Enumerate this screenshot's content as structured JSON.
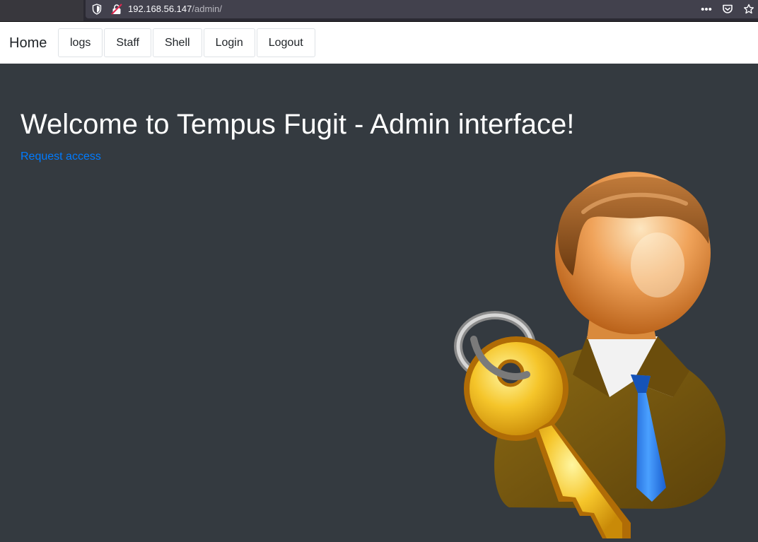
{
  "browser": {
    "url_host": "192.168.56.147",
    "url_path": "/admin/",
    "icons": [
      "shield-icon",
      "insecure-lock-icon",
      "more-actions-icon",
      "pocket-icon",
      "bookmark-star-icon"
    ]
  },
  "navbar": {
    "brand": "Home",
    "items": [
      "logs",
      "Staff",
      "Shell",
      "Login",
      "Logout"
    ]
  },
  "main": {
    "title": "Welcome to Tempus Fugit - Admin interface!",
    "link": "Request access",
    "image": "admin-with-key-illustration"
  },
  "colors": {
    "page_bg": "#343a40",
    "link": "#007bff",
    "navbar_bg": "#ffffff"
  }
}
